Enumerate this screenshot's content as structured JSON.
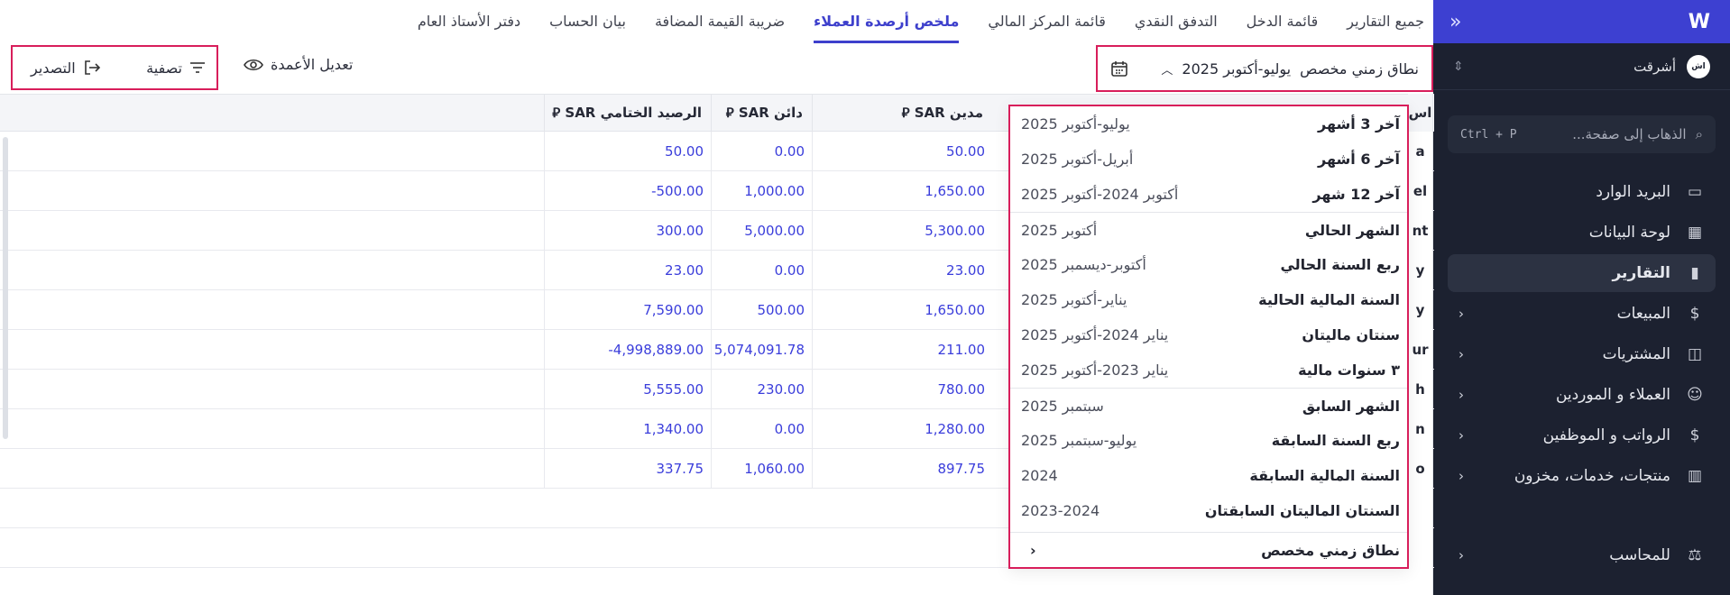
{
  "sidebar": {
    "logo": "W",
    "org_initials": "اش",
    "org_name": "أشرقت",
    "search_placeholder": "الذهاب إلى صفحة...",
    "search_shortcut": "Ctrl + P",
    "items": [
      {
        "label": "البريد الوارد",
        "icon": "inbox-icon"
      },
      {
        "label": "لوحة البيانات",
        "icon": "dashboard-icon"
      },
      {
        "label": "التقارير",
        "icon": "reports-icon",
        "active": true
      },
      {
        "label": "المبيعات",
        "icon": "dollar-circle-icon"
      },
      {
        "label": "المشتريات",
        "icon": "shopping-bag-icon"
      },
      {
        "label": "العملاء و الموردين",
        "icon": "users-icon"
      },
      {
        "label": "الرواتب و الموظفين",
        "icon": "payroll-icon"
      },
      {
        "label": "منتجات، خدمات، مخزون",
        "icon": "barcode-icon"
      },
      {
        "label": "للمحاسب",
        "icon": "accountant-icon"
      }
    ]
  },
  "tabs": [
    "جميع التقارير",
    "قائمة الدخل",
    "التدفق النقدي",
    "قائمة المركز المالي",
    "ملخص أرصدة العملاء",
    "ضريبة القيمة المضافة",
    "بيان الحساب",
    "دفتر الأستاذ العام"
  ],
  "active_tab": 4,
  "toolbar": {
    "date_label": "نطاق زمني مخصص",
    "date_value": "يوليو-أكتوبر 2025",
    "edit_columns": "تعديل الأعمدة",
    "filter": "تصفية",
    "export": "التصدير"
  },
  "table": {
    "headers": [
      "مدين SAR ⃁",
      "دائن SAR ⃁",
      "الرصيد الختامي SAR ⃁"
    ],
    "clipped_header": "اس",
    "clipped_chars": [
      "a",
      "el",
      "nt",
      "y",
      "y",
      "ur",
      "h",
      "n",
      "o"
    ],
    "rows": [
      [
        "50.00",
        "0.00",
        "50.00"
      ],
      [
        "1,650.00",
        "1,000.00",
        "-500.00"
      ],
      [
        "5,300.00",
        "5,000.00",
        "300.00"
      ],
      [
        "23.00",
        "0.00",
        "23.00"
      ],
      [
        "1,650.00",
        "500.00",
        "7,590.00"
      ],
      [
        "211.00",
        "5,074,091.78",
        "-4,998,889.00"
      ],
      [
        "780.00",
        "230.00",
        "5,555.00"
      ],
      [
        "1,280.00",
        "0.00",
        "1,340.00"
      ],
      [
        "897.75",
        "1,060.00",
        "337.75"
      ]
    ]
  },
  "dropdown": {
    "groups": [
      [
        {
          "label": "آخر 3 أشهر",
          "value": "يوليو-أكتوبر 2025"
        },
        {
          "label": "آخر 6 أشهر",
          "value": "أبريل-أكتوبر 2025"
        },
        {
          "label": "آخر 12 شهر",
          "value": "أكتوبر 2024-أكتوبر 2025"
        }
      ],
      [
        {
          "label": "الشهر الحالي",
          "value": "أكتوبر 2025"
        },
        {
          "label": "ربع السنة الحالي",
          "value": "أكتوبر-ديسمبر 2025"
        },
        {
          "label": "السنة المالية الحالية",
          "value": "يناير-أكتوبر 2025"
        },
        {
          "label": "سنتان ماليتان",
          "value": "يناير 2024-أكتوبر 2025"
        },
        {
          "label": "٣ سنوات مالية",
          "value": "يناير 2023-أكتوبر 2025"
        }
      ],
      [
        {
          "label": "الشهر السابق",
          "value": "سبتمبر 2025"
        },
        {
          "label": "ربع السنة السابقة",
          "value": "يوليو-سبتمبر 2025"
        },
        {
          "label": "السنة المالية السابقة",
          "value": "2024"
        },
        {
          "label": "السنتان الماليتان السابقتان",
          "value": "2023-2024"
        }
      ]
    ],
    "custom_label": "نطاق زمني مخصص"
  },
  "colors": {
    "accent": "#3e40cc",
    "sidebar_bg": "#1c2130",
    "highlight": "#d81e5b",
    "value_text": "#3a3ddb"
  }
}
